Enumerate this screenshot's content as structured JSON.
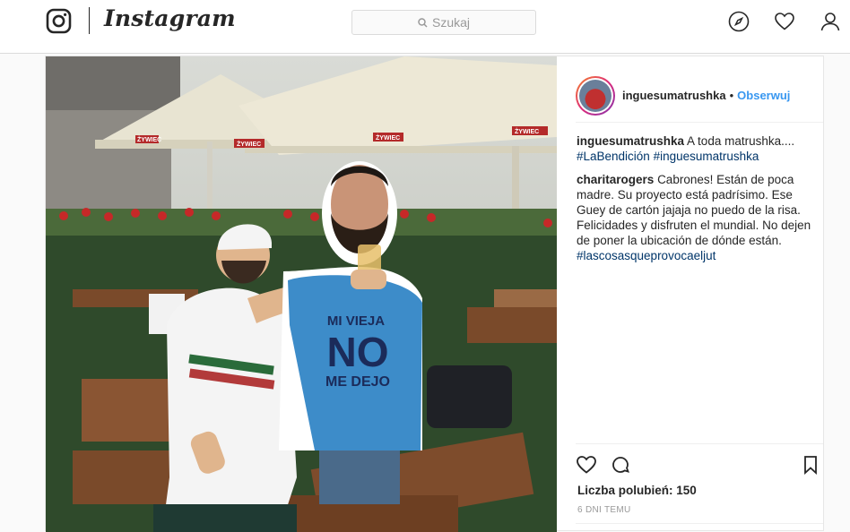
{
  "app": {
    "name": "Instagram"
  },
  "search": {
    "placeholder": "Szukaj"
  },
  "post": {
    "username": "inguesumatrushka",
    "follow_label": "Obserwuj",
    "comments": [
      {
        "user": "inguesumatrushka",
        "text": "A toda matrushka....",
        "tags": "#LaBendición #inguesumatrushka"
      },
      {
        "user": "charitarogers",
        "text": "Cabrones! Están de poca madre. Su proyecto está padrísimo. Ese Guey de cartón jajaja no puedo de la risa. Felicidades y disfruten el mundial. No dejen de poner la ubicación de dónde están.",
        "tags": "#lascosasqueprovocaeljut"
      }
    ],
    "likes_label": "Liczba polubień: 150",
    "time_label": "6 DNI TEMU",
    "photo": {
      "signs": [
        "ŻYWIEC",
        "ŻYWIEC",
        "ŻYWIEC",
        "ŻYWIEC"
      ],
      "shirt_lines": [
        "MI VIEJA",
        "NO",
        "ME DEJO"
      ]
    }
  },
  "colors": {
    "link": "#3897f0",
    "hashtag": "#003569",
    "border": "#dbdbdb"
  },
  "icons": [
    "instagram-glyph-icon",
    "search-icon",
    "compass-icon",
    "heart-icon",
    "user-icon",
    "like-icon",
    "comment-icon",
    "bookmark-icon"
  ]
}
